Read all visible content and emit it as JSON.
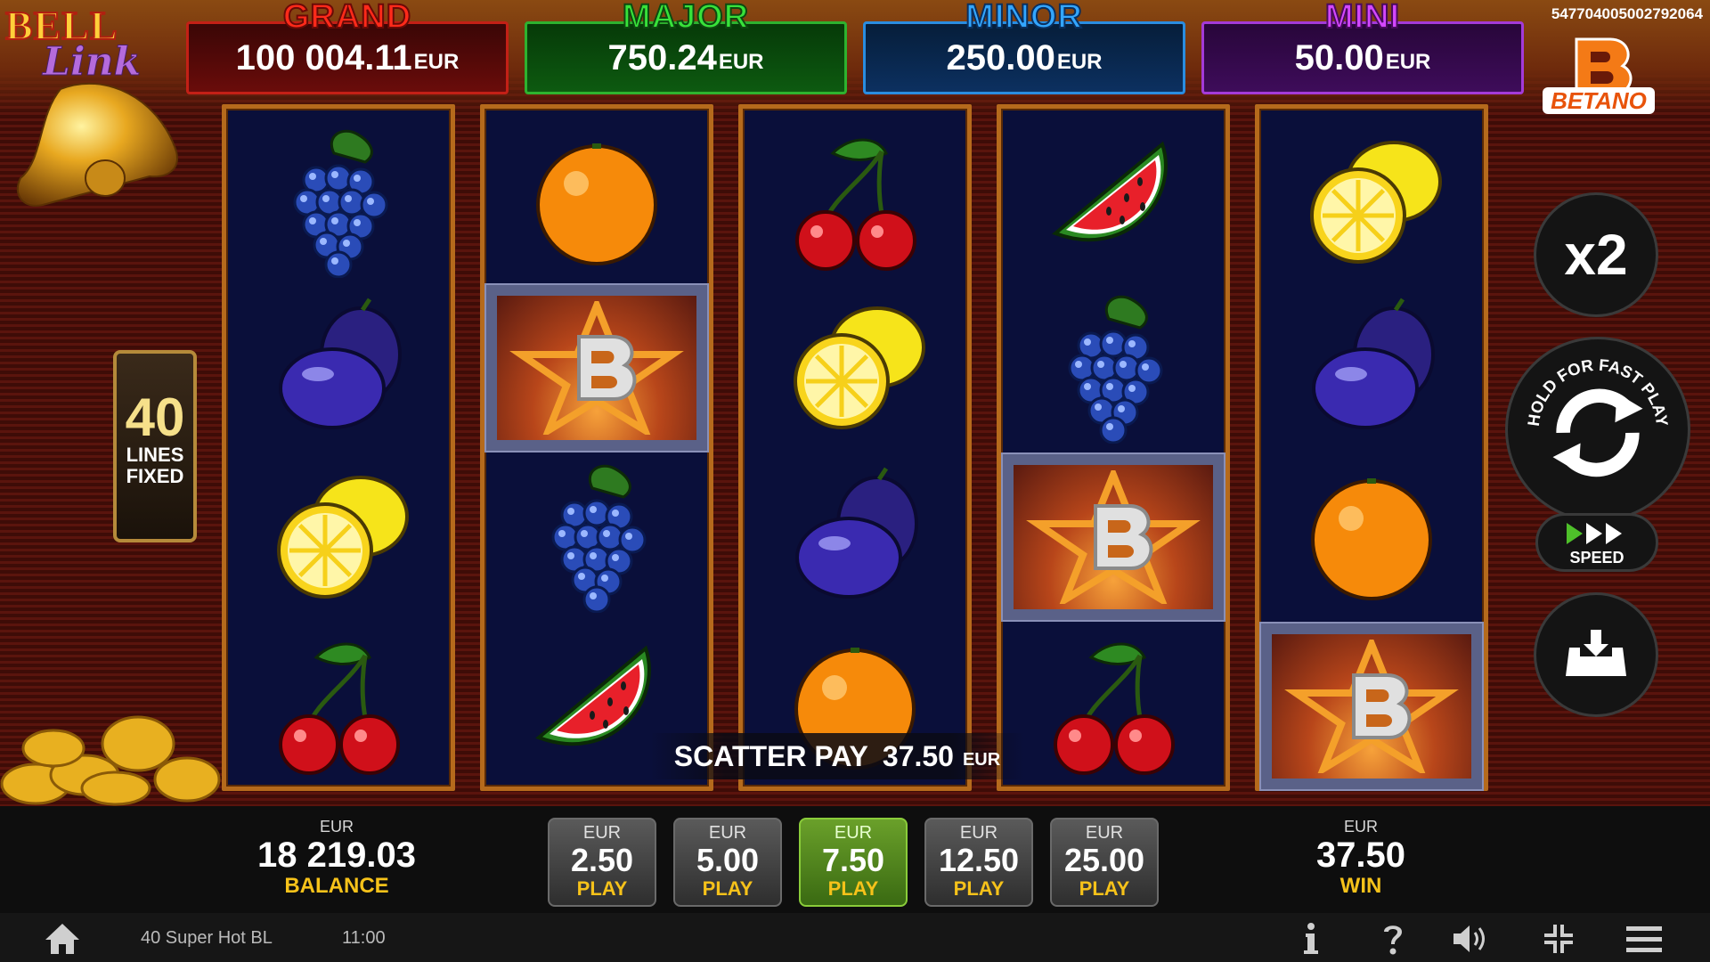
{
  "logo": {
    "line1": "BELL",
    "line2": "Link"
  },
  "jackpots": [
    {
      "title": "GRAND",
      "value": "100 004.11",
      "currency": "EUR"
    },
    {
      "title": "MAJOR",
      "value": "750.24",
      "currency": "EUR"
    },
    {
      "title": "MINOR",
      "value": "250.00",
      "currency": "EUR"
    },
    {
      "title": "MINI",
      "value": "50.00",
      "currency": "EUR"
    }
  ],
  "session_id": "5477040050027920​64",
  "brand": "BETANO",
  "lines": {
    "count": "40",
    "label1": "LINES",
    "label2": "FIXED"
  },
  "reels": [
    [
      "grapes",
      "plum",
      "lemon",
      "cherries"
    ],
    [
      "orange",
      "scatter",
      "grapes",
      "watermelon"
    ],
    [
      "cherries",
      "lemon",
      "plum",
      "orange"
    ],
    [
      "watermelon",
      "grapes",
      "scatter",
      "cherries"
    ],
    [
      "lemon",
      "plum",
      "orange",
      "scatter"
    ]
  ],
  "scatter_pay": {
    "label": "SCATTER PAY",
    "value": "37.50",
    "currency": "EUR"
  },
  "controls": {
    "multiplier": "x2",
    "spin_hint": "HOLD FOR FAST PLAY",
    "speed_label": "SPEED"
  },
  "balance": {
    "currency": "EUR",
    "value": "18 219.03",
    "label": "BALANCE"
  },
  "win": {
    "currency": "EUR",
    "value": "37.50",
    "label": "WIN"
  },
  "bets": [
    {
      "currency": "EUR",
      "value": "2.50",
      "label": "PLAY",
      "active": false
    },
    {
      "currency": "EUR",
      "value": "5.00",
      "label": "PLAY",
      "active": false
    },
    {
      "currency": "EUR",
      "value": "7.50",
      "label": "PLAY",
      "active": true
    },
    {
      "currency": "EUR",
      "value": "12.50",
      "label": "PLAY",
      "active": false
    },
    {
      "currency": "EUR",
      "value": "25.00",
      "label": "PLAY",
      "active": false
    }
  ],
  "footer": {
    "game_name": "40 Super Hot BL",
    "time": "11:00"
  },
  "colors": {
    "active_bet": "#5a9a22",
    "label_yellow": "#f6c21a",
    "reel_bg": "#0a0f3a",
    "reel_frame": "#b56a1c"
  }
}
